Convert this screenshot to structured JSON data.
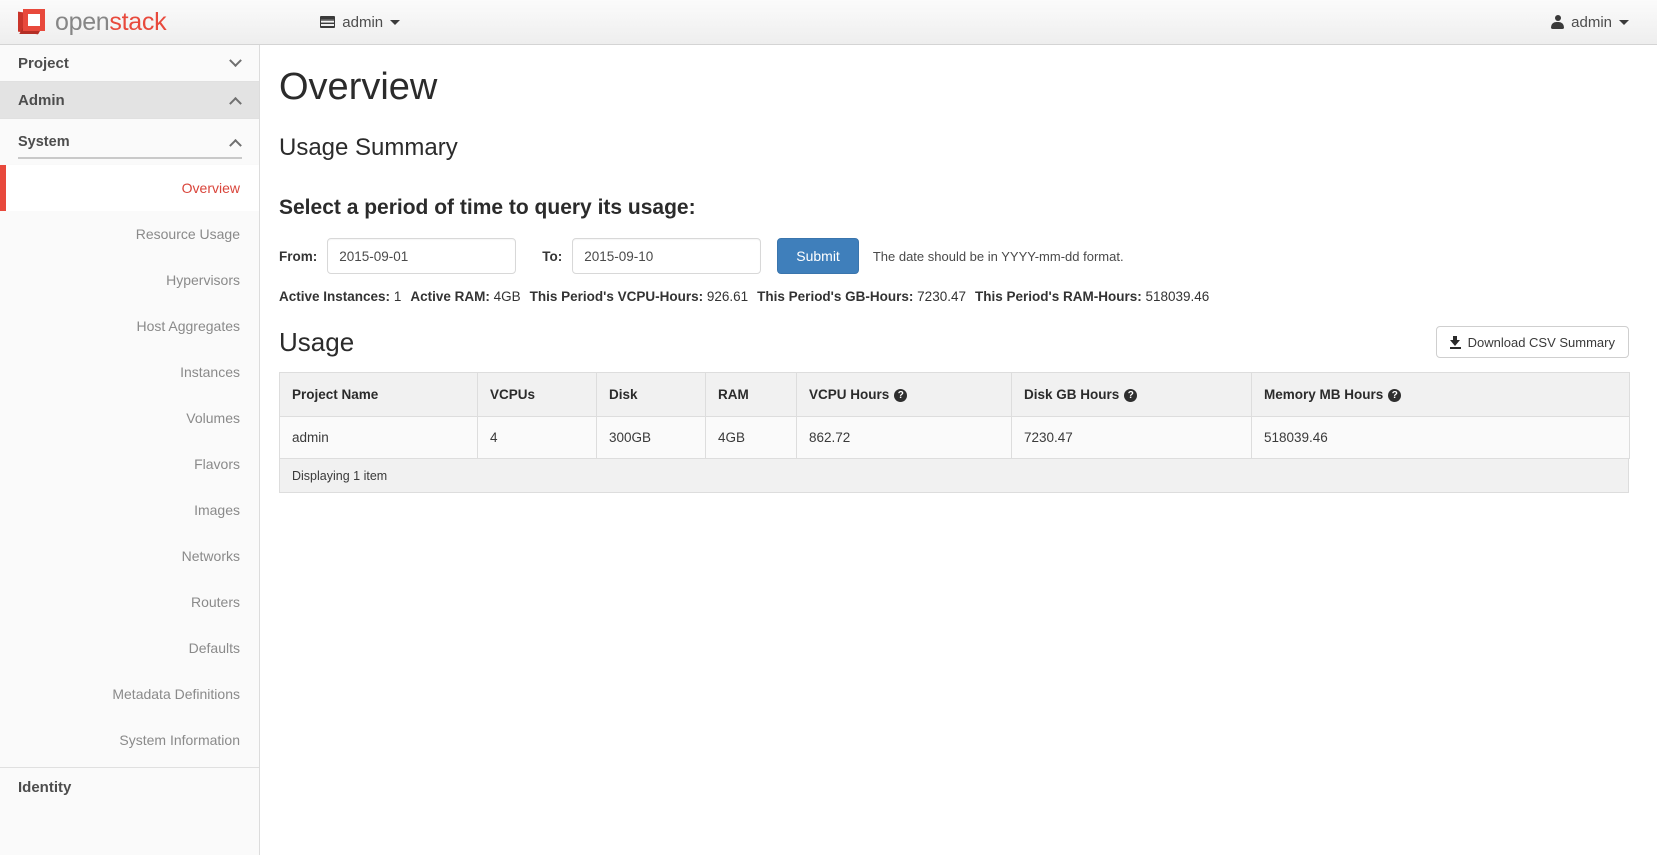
{
  "topbar": {
    "brand": {
      "part1": "open",
      "part2": "stack"
    },
    "context_switcher": {
      "label": "admin",
      "icon": "list-icon"
    },
    "user_menu": {
      "label": "admin",
      "icon": "person-icon"
    }
  },
  "sidebar": {
    "sections": [
      {
        "label": "Project",
        "state": "collapsed",
        "chevron": "chevron-down-icon"
      },
      {
        "label": "Admin",
        "state": "expanded",
        "chevron": "chevron-up-icon"
      }
    ],
    "subheader": {
      "label": "System",
      "chevron": "chevron-up-icon"
    },
    "items": [
      {
        "label": "Overview",
        "active": true
      },
      {
        "label": "Resource Usage",
        "active": false
      },
      {
        "label": "Hypervisors",
        "active": false
      },
      {
        "label": "Host Aggregates",
        "active": false
      },
      {
        "label": "Instances",
        "active": false
      },
      {
        "label": "Volumes",
        "active": false
      },
      {
        "label": "Flavors",
        "active": false
      },
      {
        "label": "Images",
        "active": false
      },
      {
        "label": "Networks",
        "active": false
      },
      {
        "label": "Routers",
        "active": false
      },
      {
        "label": "Defaults",
        "active": false
      },
      {
        "label": "Metadata Definitions",
        "active": false
      },
      {
        "label": "System Information",
        "active": false
      }
    ],
    "bottom_section": {
      "label": "Identity"
    }
  },
  "main": {
    "page_title": "Overview",
    "section_title": "Usage Summary",
    "form_title": "Select a period of time to query its usage:",
    "form": {
      "from_label": "From:",
      "from_value": "2015-09-01",
      "to_label": "To:",
      "to_value": "2015-09-10",
      "submit_label": "Submit",
      "hint": "The date should be in YYYY-mm-dd format."
    },
    "stats": [
      {
        "key": "Active Instances:",
        "value": "1"
      },
      {
        "key": "Active RAM:",
        "value": "4GB"
      },
      {
        "key": "This Period's VCPU-Hours:",
        "value": "926.61"
      },
      {
        "key": "This Period's GB-Hours:",
        "value": "7230.47"
      },
      {
        "key": "This Period's RAM-Hours:",
        "value": "518039.46"
      }
    ],
    "usage_title": "Usage",
    "csv_button": {
      "label": "Download CSV Summary",
      "icon": "download-icon"
    },
    "table": {
      "columns": [
        {
          "label": "Project Name",
          "help": false
        },
        {
          "label": "VCPUs",
          "help": false
        },
        {
          "label": "Disk",
          "help": false
        },
        {
          "label": "RAM",
          "help": false
        },
        {
          "label": "VCPU Hours",
          "help": true
        },
        {
          "label": "Disk GB Hours",
          "help": true
        },
        {
          "label": "Memory MB Hours",
          "help": true
        }
      ],
      "help_glyph": "?",
      "rows": [
        {
          "project_name": "admin",
          "vcpus": "4",
          "disk": "300GB",
          "ram": "4GB",
          "vcpu_hours": "862.72",
          "disk_gb_hours": "7230.47",
          "memory_mb_hours": "518039.46"
        }
      ],
      "footer": "Displaying 1 item"
    }
  },
  "colors": {
    "brand_red": "#e8493c",
    "active_red": "#d9443a",
    "submit_blue": "#3f7fbb",
    "sidebar_bg": "#fafafa",
    "table_header_bg": "#f1f1f1",
    "border": "#dddddd"
  }
}
